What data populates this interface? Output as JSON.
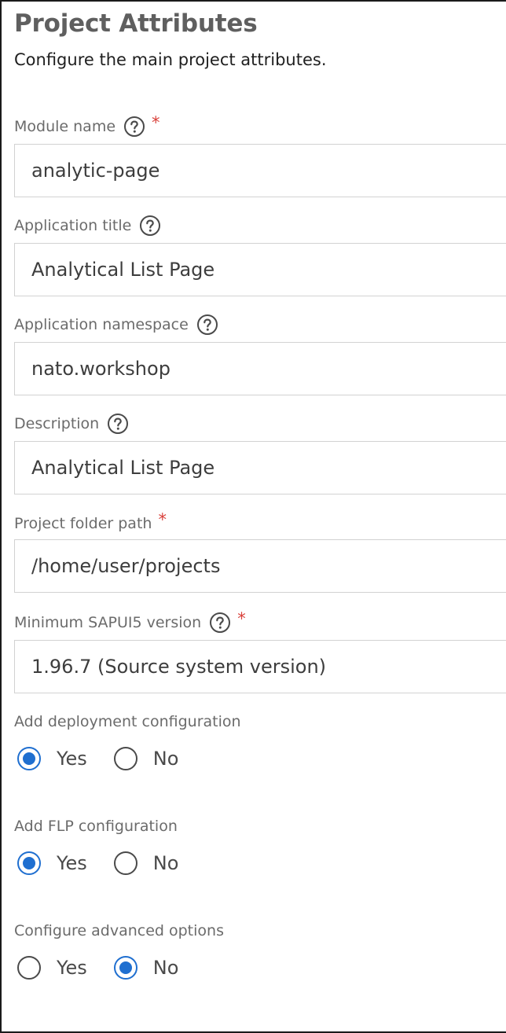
{
  "header": {
    "title": "Project Attributes",
    "subtitle": "Configure the main project attributes."
  },
  "fields": {
    "module_name": {
      "label": "Module name",
      "value": "analytic-page",
      "required_mark": "*",
      "help_icon": "question-circle-icon"
    },
    "application_title": {
      "label": "Application title",
      "value": "Analytical List Page",
      "help_icon": "question-circle-icon"
    },
    "application_namespace": {
      "label": "Application namespace",
      "value": "nato.workshop",
      "help_icon": "question-circle-icon"
    },
    "description": {
      "label": "Description",
      "value": "Analytical List Page",
      "help_icon": "question-circle-icon"
    },
    "project_folder_path": {
      "label": "Project folder path",
      "value": "/home/user/projects",
      "required_mark": "*"
    },
    "minimum_sapui5_version": {
      "label": "Minimum SAPUI5 version",
      "value": "1.96.7 (Source system version)",
      "required_mark": "*",
      "help_icon": "question-circle-icon"
    }
  },
  "radio_groups": {
    "deployment": {
      "label": "Add deployment configuration",
      "options": [
        "Yes",
        "No"
      ],
      "selected": "Yes"
    },
    "flp": {
      "label": "Add FLP configuration",
      "options": [
        "Yes",
        "No"
      ],
      "selected": "Yes"
    },
    "advanced": {
      "label": "Configure advanced options",
      "options": [
        "Yes",
        "No"
      ],
      "selected": "No"
    }
  },
  "colors": {
    "accent": "#1f6fd0",
    "required": "#d9413b",
    "label": "#6b6b6b",
    "title": "#5f5f5f",
    "input_border": "#d2d2d2"
  }
}
